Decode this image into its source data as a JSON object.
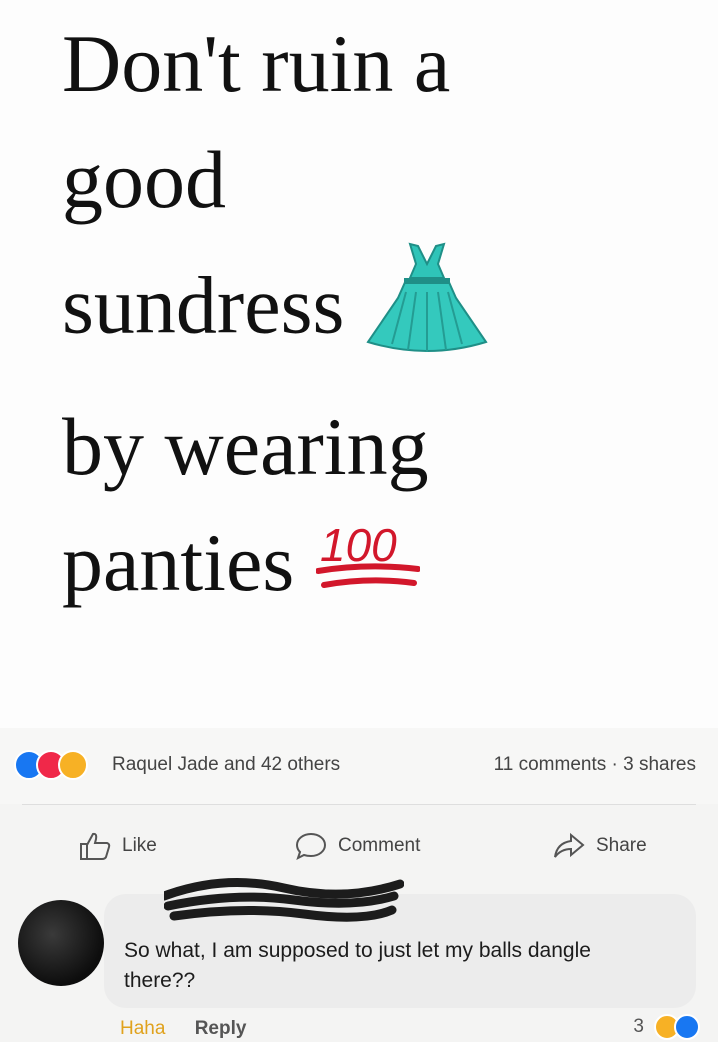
{
  "post": {
    "lines": [
      "Don't ruin a",
      "good",
      "sundress",
      "by wearing",
      "panties"
    ],
    "emoji": [
      "dress-emoji",
      "hundred-points-emoji"
    ],
    "hundred_label": "100"
  },
  "stats": {
    "reactions": [
      "like-reaction-icon",
      "love-reaction-icon",
      "haha-reaction-icon"
    ],
    "names": "Raquel Jade and 42 others",
    "counts": "11 comments · 3 shares"
  },
  "actions": {
    "like": "Like",
    "comment": "Comment",
    "share": "Share"
  },
  "comment": {
    "text": "So what, I am supposed to just let my balls dangle there??",
    "reaction_link": "Haha",
    "reply_link": "Reply",
    "reaction_count": "3"
  },
  "colors": {
    "like_blue": "#1877f2",
    "love_red": "#f02849",
    "haha_yellow": "#f7b125",
    "dress_teal": "#2fc4b8",
    "hundred_red": "#d2172b"
  }
}
